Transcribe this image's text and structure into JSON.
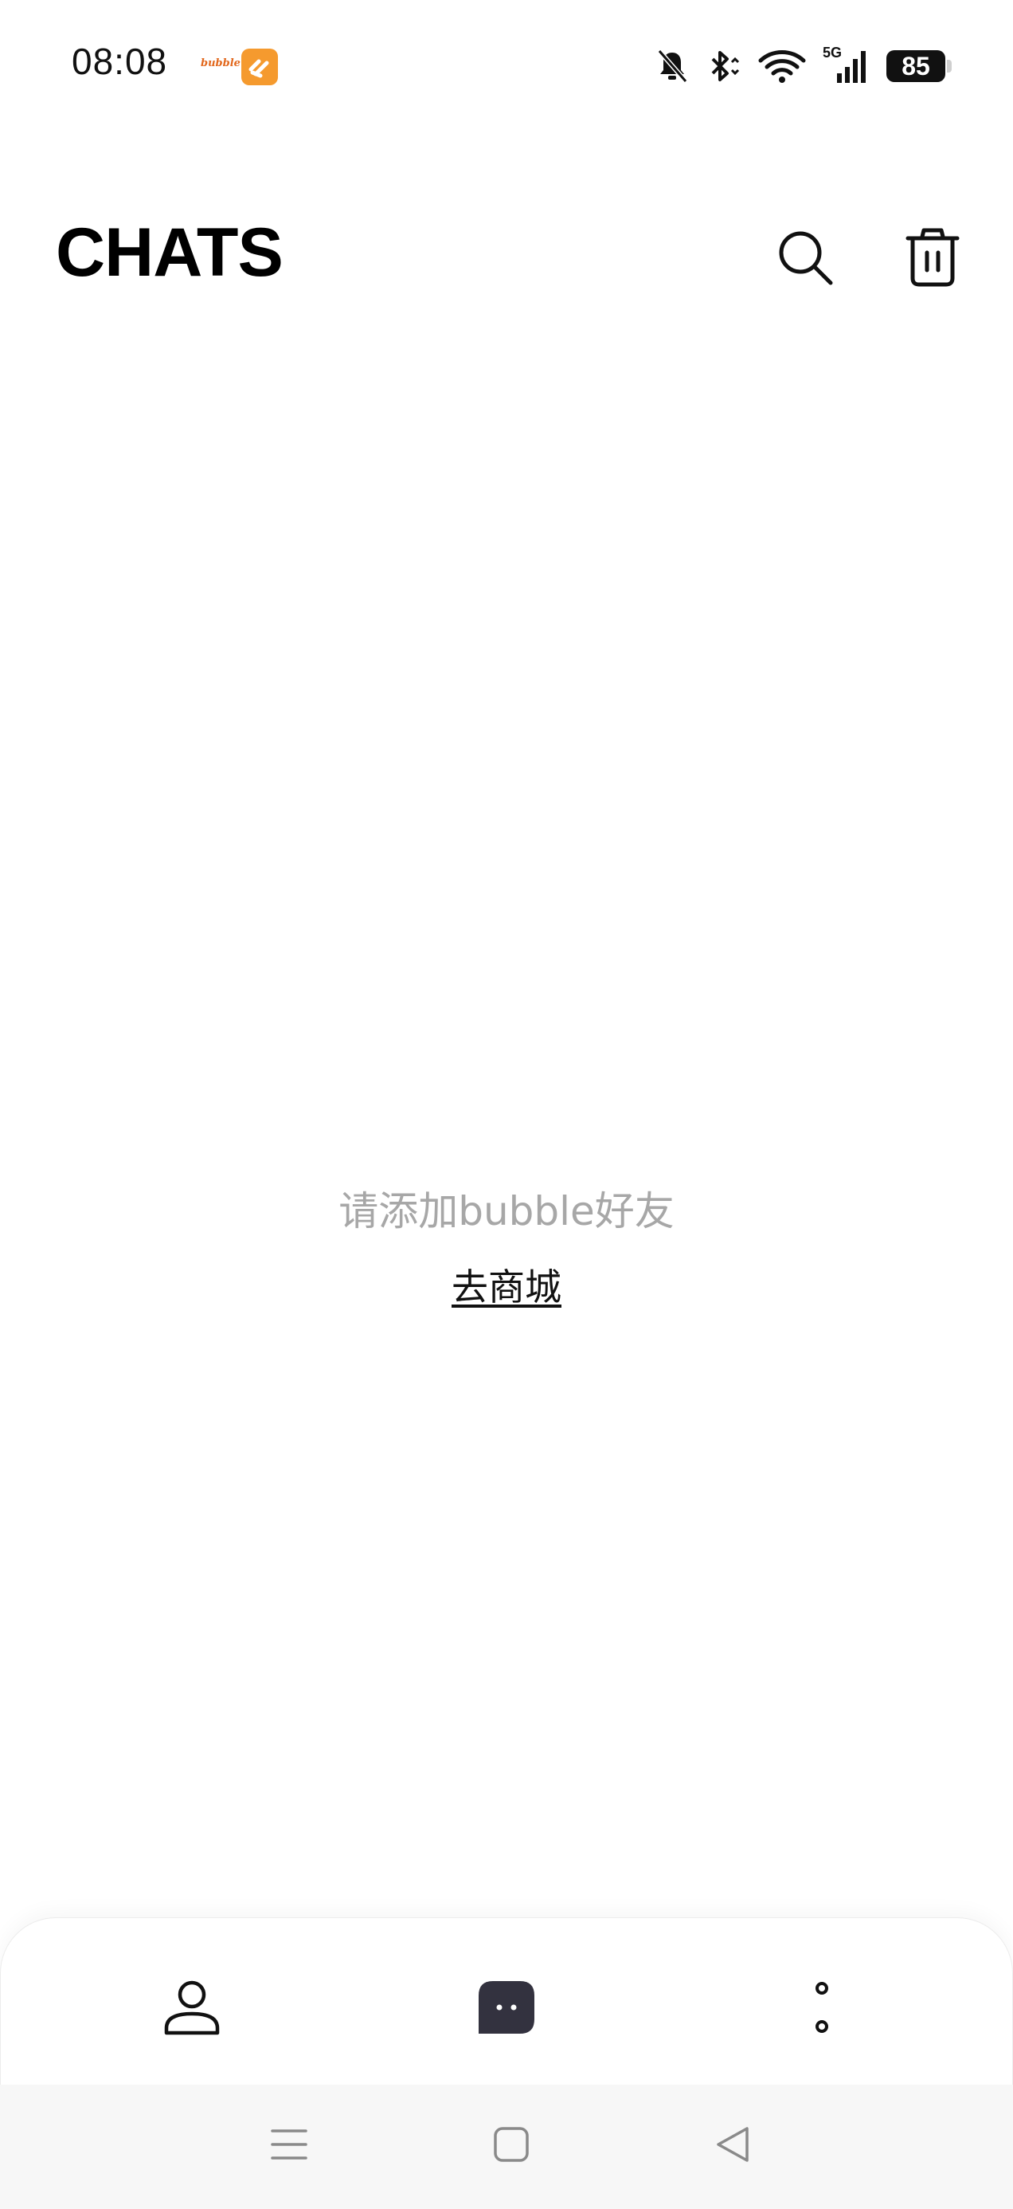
{
  "status_bar": {
    "time": "08:08",
    "app_label": "bubble",
    "network": "5G",
    "battery": "85"
  },
  "header": {
    "title": "CHATS"
  },
  "empty_state": {
    "hint": "请添加bubble好友",
    "link": "去商城"
  },
  "icons": {
    "search": "search-icon",
    "trash": "trash-icon",
    "profile": "person-icon",
    "chats": "chat-bubble-icon",
    "more": "more-dots-icon"
  },
  "colors": {
    "background": "#ffffff",
    "title": "#000000",
    "hint_text": "#a7a7a7",
    "chat_tab_active": "#33323f",
    "app_badge": "#f59a2e"
  }
}
